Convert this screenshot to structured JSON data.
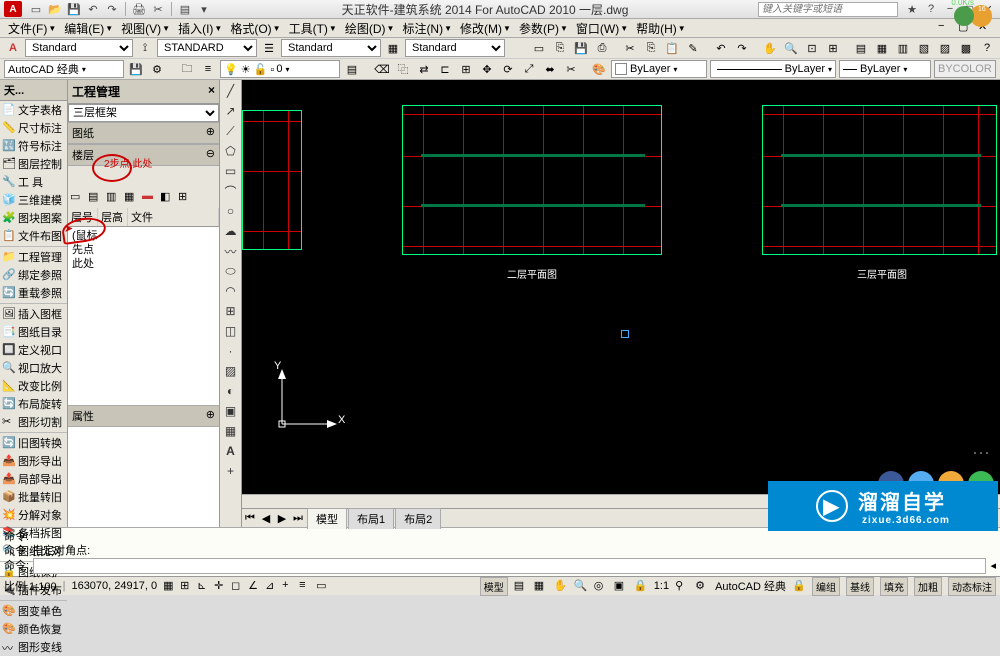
{
  "title": "天正软件-建筑系统 2014  For AutoCAD 2010  一层.dwg",
  "search_placeholder": "键入关键字或短语",
  "menus": [
    "文件(F)",
    "编辑(E)",
    "视图(V)",
    "插入(I)",
    "格式(O)",
    "工具(T)",
    "绘图(D)",
    "标注(N)",
    "修改(M)",
    "参数(P)",
    "窗口(W)",
    "帮助(H)"
  ],
  "tb1": {
    "style1": "Standard",
    "style2": "STANDARD",
    "style3": "Standard",
    "style4": "Standard"
  },
  "tb2": {
    "workspace": "AutoCAD 经典",
    "layer_combo": "0",
    "bylayer1": "ByLayer",
    "bylayer2": "ByLayer",
    "bylayer3": "ByLayer",
    "bycolor": "BYCOLOR"
  },
  "sidebar": {
    "header": "天...",
    "groups": [
      [
        "文字表格",
        "尺寸标注",
        "符号标注",
        "图层控制",
        "工    具",
        "三维建模",
        "图块图案",
        "文件布图"
      ],
      [
        "工程管理",
        "绑定参照",
        "重载参照"
      ],
      [
        "插入图框",
        "图纸目录",
        "定义视口",
        "视口放大",
        "改变比例",
        "布局旋转",
        "图形切割"
      ],
      [
        "旧图转换",
        "图形导出",
        "局部导出",
        "批量转旧",
        "分解对象",
        "备档拆图",
        "图纸比对"
      ],
      [
        "图纸保护",
        "插件发布"
      ],
      [
        "图变单色",
        "颜色恢复",
        "图形变线"
      ]
    ]
  },
  "panel": {
    "header": "工程管理",
    "project_combo": "三层框架",
    "sec1": "图纸",
    "sec2": "楼层",
    "annotation": "2步点\n此处",
    "cols": [
      "层号",
      "层高",
      "文件"
    ],
    "body_lines": [
      "(鼠标",
      "先点",
      "此处"
    ],
    "sec3": "属性"
  },
  "tabs": {
    "active": "模型",
    "others": [
      "布局1",
      "布局2"
    ]
  },
  "cmd": {
    "line1": "命令:",
    "line2": "命令:  指定对角点:",
    "prompt": "命令:"
  },
  "canvas": {
    "label1": "二层平面图",
    "label2": "三层平面图",
    "axis_y": "Y",
    "axis_x": "X"
  },
  "status": {
    "scale": "比例 1:100",
    "coords": "163070, 24917, 0",
    "mid_buttons": [
      "模型"
    ],
    "right": [
      "AutoCAD 经典",
      "编组",
      "基线",
      "填充",
      "加粗",
      "动态标注"
    ],
    "lock": "1:1"
  },
  "watermark": {
    "main": "溜溜自学",
    "sub": "zixue.3d66.com"
  },
  "stamp": {
    "speed": "0.0K/s"
  }
}
